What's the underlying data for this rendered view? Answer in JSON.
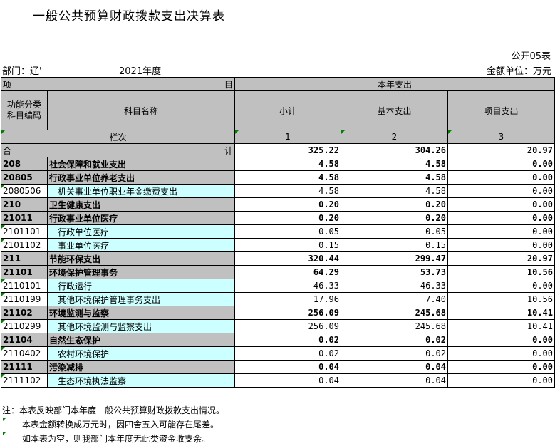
{
  "title": "一般公共预算财政拨款支出决算表",
  "form_no": "公开05表",
  "dept_label": "部门：辽'",
  "year_label": "2021年度",
  "unit_label": "金额单位：万元",
  "header": {
    "xiang": "项",
    "mu": "目",
    "current_year": "本年支出",
    "code_col": "功能分类\n科目编码",
    "name_col": "科目名称",
    "subtotal": "小计",
    "basic": "基本支出",
    "project": "项目支出",
    "lanci": "栏次",
    "col1": "1",
    "col2": "2",
    "col3": "3"
  },
  "total": {
    "he": "合",
    "ji": "计",
    "subtotal": "325.22",
    "basic": "304.26",
    "project": "20.97"
  },
  "rows": [
    {
      "code": "208",
      "name": "社会保障和就业支出",
      "subtotal": "4.58",
      "basic": "4.58",
      "project": "0.00",
      "level": 1
    },
    {
      "code": "20805",
      "name": "行政事业单位养老支出",
      "subtotal": "4.58",
      "basic": "4.58",
      "project": "0.00",
      "level": 1
    },
    {
      "code": "2080506",
      "name": "机关事业单位职业年金缴费支出",
      "subtotal": "4.58",
      "basic": "4.58",
      "project": "0.00",
      "level": 2
    },
    {
      "code": "210",
      "name": "卫生健康支出",
      "subtotal": "0.20",
      "basic": "0.20",
      "project": "0.00",
      "level": 1
    },
    {
      "code": "21011",
      "name": "行政事业单位医疗",
      "subtotal": "0.20",
      "basic": "0.20",
      "project": "0.00",
      "level": 1
    },
    {
      "code": "2101101",
      "name": "行政单位医疗",
      "subtotal": "0.05",
      "basic": "0.05",
      "project": "0.00",
      "level": 2
    },
    {
      "code": "2101102",
      "name": "事业单位医疗",
      "subtotal": "0.15",
      "basic": "0.15",
      "project": "0.00",
      "level": 2
    },
    {
      "code": "211",
      "name": "节能环保支出",
      "subtotal": "320.44",
      "basic": "299.47",
      "project": "20.97",
      "level": 1
    },
    {
      "code": "21101",
      "name": "环境保护管理事务",
      "subtotal": "64.29",
      "basic": "53.73",
      "project": "10.56",
      "level": 1
    },
    {
      "code": "2110101",
      "name": "行政运行",
      "subtotal": "46.33",
      "basic": "46.33",
      "project": "0.00",
      "level": 2
    },
    {
      "code": "2110199",
      "name": "其他环境保护管理事务支出",
      "subtotal": "17.96",
      "basic": "7.40",
      "project": "10.56",
      "level": 2
    },
    {
      "code": "21102",
      "name": "环境监测与监察",
      "subtotal": "256.09",
      "basic": "245.68",
      "project": "10.41",
      "level": 1
    },
    {
      "code": "2110299",
      "name": "其他环境监测与监察支出",
      "subtotal": "256.09",
      "basic": "245.68",
      "project": "10.41",
      "level": 2
    },
    {
      "code": "21104",
      "name": "自然生态保护",
      "subtotal": "0.02",
      "basic": "0.02",
      "project": "0.00",
      "level": 1
    },
    {
      "code": "2110402",
      "name": "农村环境保护",
      "subtotal": "0.02",
      "basic": "0.02",
      "project": "0.00",
      "level": 2
    },
    {
      "code": "21111",
      "name": "污染减排",
      "subtotal": "0.04",
      "basic": "0.04",
      "project": "0.00",
      "level": 1
    },
    {
      "code": "2111102",
      "name": "生态环境执法监察",
      "subtotal": "0.04",
      "basic": "0.04",
      "project": "0.00",
      "level": 2
    }
  ],
  "notes": [
    "注：本表反映部门本年度一般公共预算财政拨款支出情况。",
    "本表金额转换成万元时，因四舍五入可能存在尾差。",
    "如本表为空，则我部门本年度无此类资金收支余。"
  ],
  "colors": {
    "header_gray": "#c0c0c0",
    "detail_cyan": "#ccffff",
    "marker_green": "#008000"
  }
}
